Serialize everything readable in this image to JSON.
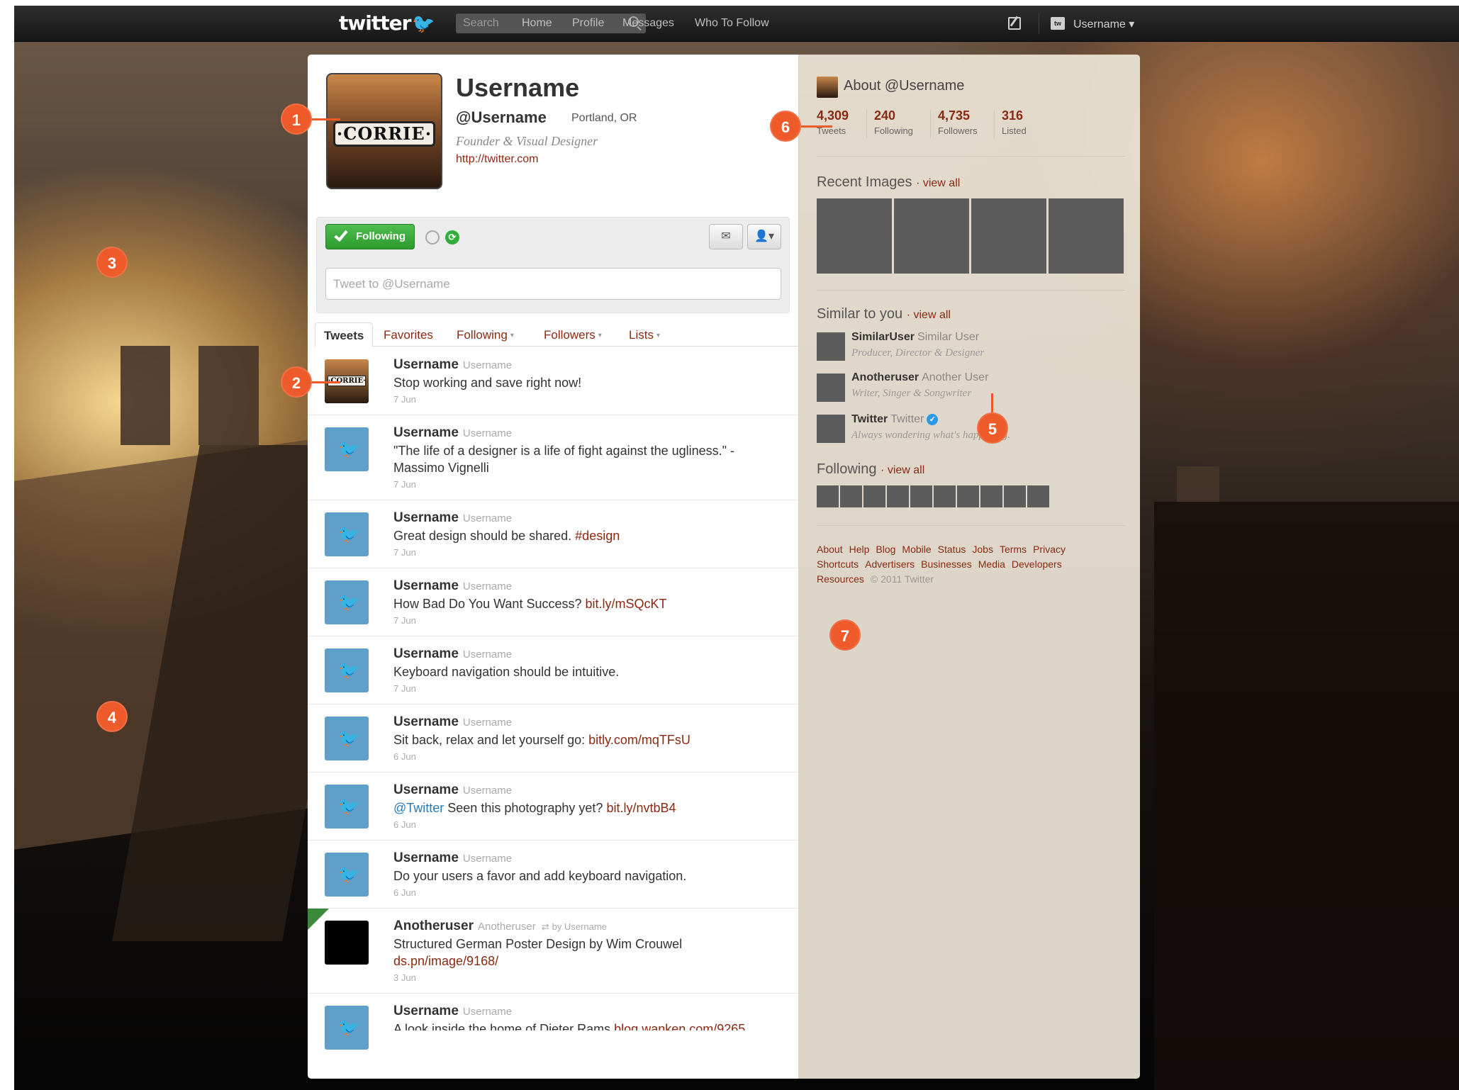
{
  "topbar": {
    "logo": "twitter",
    "search_placeholder": "Search",
    "nav": [
      "Home",
      "Profile",
      "Messages",
      "Who To Follow"
    ],
    "account_name": "Username",
    "account_caret": "▾"
  },
  "profile": {
    "avatar_sign": "·CORRIE·",
    "name": "Username",
    "handle": "@Username",
    "location": "Portland, OR",
    "bio": "Founder & Visual Designer",
    "url": "http://twitter.com"
  },
  "actions": {
    "follow_label": "Following",
    "tweet_placeholder": "Tweet to @Username"
  },
  "tabs": [
    {
      "label": "Tweets",
      "caret": ""
    },
    {
      "label": "Favorites",
      "caret": ""
    },
    {
      "label": "Following",
      "caret": "▾"
    },
    {
      "label": "Followers",
      "caret": "▾"
    },
    {
      "label": "Lists",
      "caret": "▾"
    }
  ],
  "tweets": [
    {
      "name": "Username",
      "user": "Username",
      "text": "Stop working and save right now!",
      "link": "",
      "date": "7 Jun"
    },
    {
      "name": "Username",
      "user": "Username",
      "text": "\"The life of a designer is a life of fight against the ugliness.\" - Massimo Vignelli",
      "link": "",
      "date": "7 Jun"
    },
    {
      "name": "Username",
      "user": "Username",
      "text": "Great design should be shared. ",
      "link": "#design",
      "date": "7 Jun"
    },
    {
      "name": "Username",
      "user": "Username",
      "text": "How Bad Do You Want Success? ",
      "link": "bit.ly/mSQcKT",
      "date": "7 Jun"
    },
    {
      "name": "Username",
      "user": "Username",
      "text": "Keyboard navigation should be intuitive.",
      "link": "",
      "date": "7 Jun"
    },
    {
      "name": "Username",
      "user": "Username",
      "text": "Sit back, relax and let yourself go: ",
      "link": "bitly.com/mqTFsU",
      "date": "6 Jun"
    },
    {
      "name": "Username",
      "user": "Username",
      "mention": "@Twitter",
      "text": " Seen this photography yet? ",
      "link": "bit.ly/nvtbB4",
      "date": "6 Jun"
    },
    {
      "name": "Username",
      "user": "Username",
      "text": "Do your users a favor and add keyboard navigation.",
      "link": "",
      "date": "6 Jun"
    },
    {
      "name": "Anotheruser",
      "user": "Anotheruser",
      "rt_by": "by Username",
      "text": "Structured German Poster Design by Wim Crouwel",
      "link": "ds.pn/image/9168/",
      "date": "3 Jun"
    },
    {
      "name": "Username",
      "user": "Username",
      "text": "A look inside the home of Dieter Rams ",
      "link": "blog.wanken.com/9265",
      "date": ""
    }
  ],
  "sidebar": {
    "about_title": "About @Username",
    "stats": [
      {
        "num": "4,309",
        "label": "Tweets"
      },
      {
        "num": "240",
        "label": "Following"
      },
      {
        "num": "4,735",
        "label": "Followers"
      },
      {
        "num": "316",
        "label": "Listed"
      }
    ],
    "recent_images_title": "Recent Images",
    "view_all": "· view all",
    "similar_title": "Similar to you",
    "similar": [
      {
        "name": "SimilarUser",
        "sub": "Similar User",
        "bio": "Producer, Director & Designer"
      },
      {
        "name": "Anotheruser",
        "sub": "Another User",
        "bio": "Writer, Singer & Songwriter"
      },
      {
        "name": "Twitter",
        "sub": "Twitter",
        "bio": "Always wondering what's happening."
      }
    ],
    "following_title": "Following",
    "footer_row1": [
      "About",
      "Help",
      "Blog",
      "Mobile",
      "Status",
      "Jobs",
      "Terms",
      "Privacy"
    ],
    "footer_row2": [
      "Shortcuts",
      "Advertisers",
      "Businesses",
      "Media",
      "Developers"
    ],
    "footer_row3": [
      "Resources"
    ],
    "copyright": "© 2011 Twitter"
  },
  "callouts": [
    "1",
    "2",
    "3",
    "4",
    "5",
    "6",
    "7"
  ],
  "colors": {
    "accent": "#8a2a12",
    "callout": "#ee5a2a",
    "follow_green": "#2e9a2e"
  }
}
